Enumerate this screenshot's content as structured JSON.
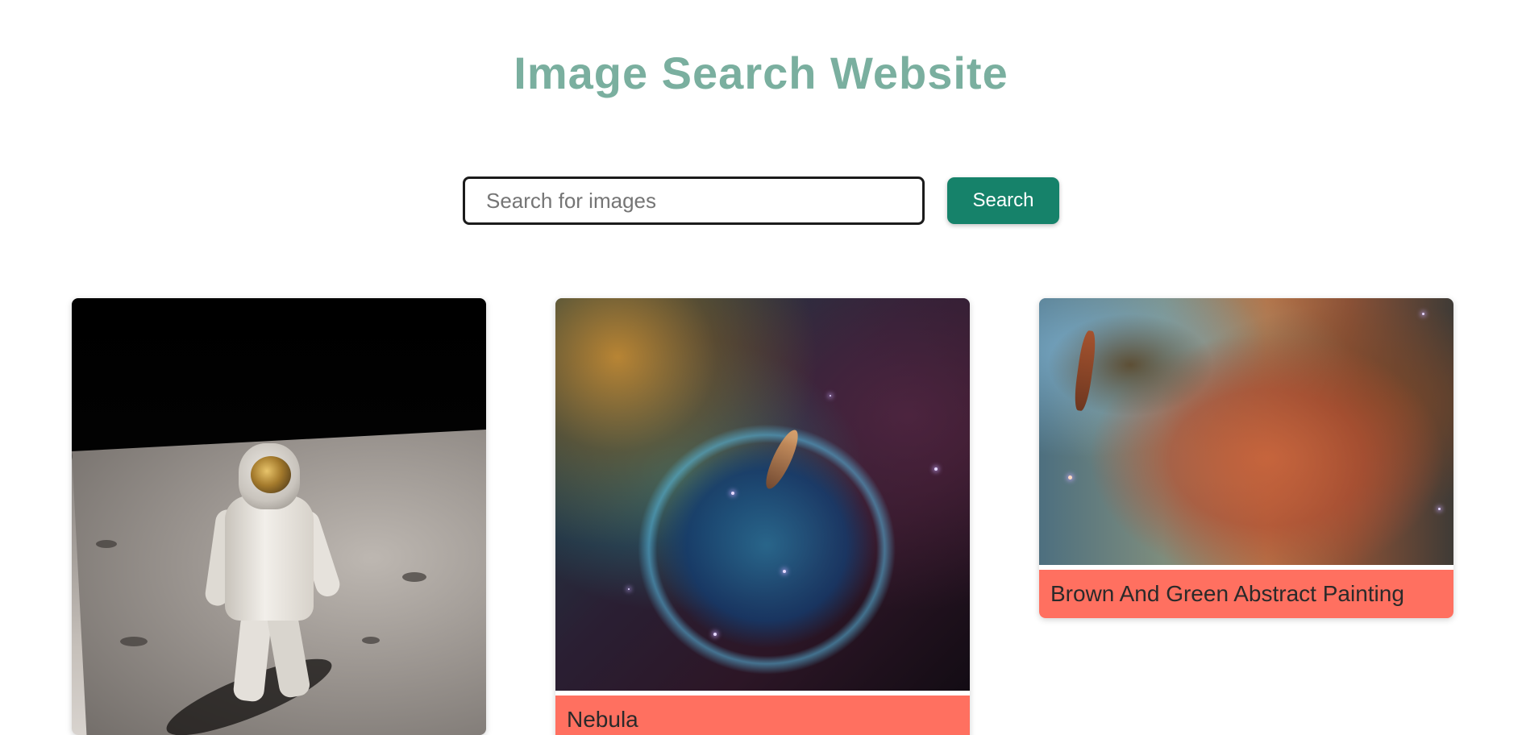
{
  "header": {
    "title": "Image Search Website"
  },
  "search": {
    "placeholder": "Search for images",
    "value": "",
    "button_label": "Search"
  },
  "results": [
    {
      "caption": "",
      "image_icon": "astronaut-on-moon-image"
    },
    {
      "caption": "Nebula",
      "image_icon": "nebula-image"
    },
    {
      "caption": "Brown And Green Abstract Painting",
      "image_icon": "abstract-painting-image"
    }
  ],
  "colors": {
    "title": "#7aaf9f",
    "search_button": "#16826a",
    "caption_background": "#ff7060",
    "input_border": "#1b1b1b"
  }
}
